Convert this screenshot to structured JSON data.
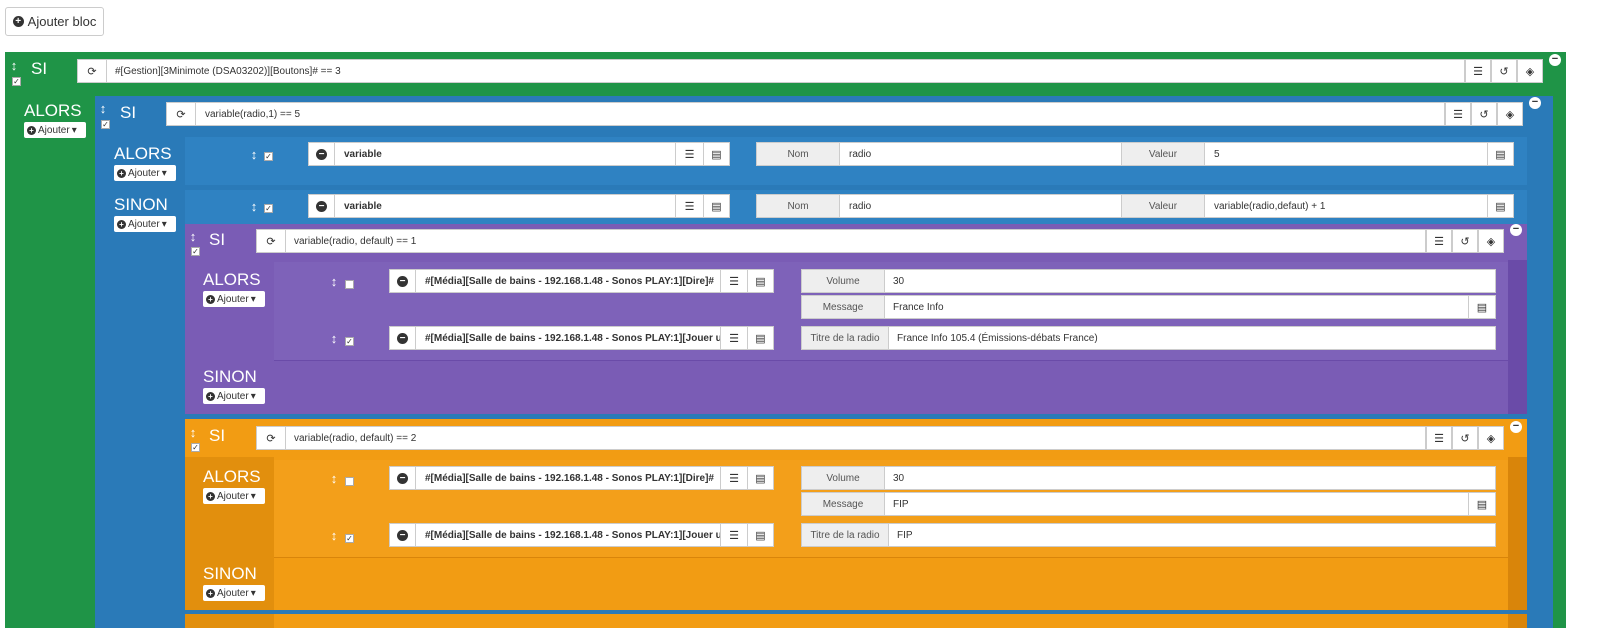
{
  "toolbar": {
    "add_block_label": "Ajouter bloc"
  },
  "labels": {
    "si": "SI",
    "alors": "ALORS",
    "sinon": "SINON",
    "ajouter": "Ajouter"
  },
  "root": {
    "condition": "#[Gestion][3Minimote (DSA03202)][Boutons]# == 3"
  },
  "blue": {
    "condition": "variable(radio,1) == 5",
    "then_action": {
      "cmd": "variable",
      "name_label": "Nom",
      "name": "radio",
      "value_label": "Valeur",
      "value": "5"
    },
    "else_action": {
      "cmd": "variable",
      "name_label": "Nom",
      "name": "radio",
      "value_label": "Valeur",
      "value": "variable(radio,defaut) + 1"
    }
  },
  "purple": {
    "condition": "variable(radio, default) == 1",
    "say": {
      "cmd": "#[Média][Salle de bains - 192.168.1.48 - Sonos PLAY:1][Dire]#",
      "volume_label": "Volume",
      "volume": "30",
      "message_label": "Message",
      "message": "France Info"
    },
    "play": {
      "cmd": "#[Média][Salle de bains - 192.168.1.48 - Sonos PLAY:1][Jouer ur",
      "title_label": "Titre de la radio",
      "title": "France Info 105.4 (Émissions-débats France)"
    }
  },
  "orange": {
    "condition": "variable(radio, default) == 2",
    "say": {
      "cmd": "#[Média][Salle de bains - 192.168.1.48 - Sonos PLAY:1][Dire]#",
      "volume_label": "Volume",
      "volume": "30",
      "message_label": "Message",
      "message": "FIP"
    },
    "play": {
      "cmd": "#[Média][Salle de bains - 192.168.1.48 - Sonos PLAY:1][Jouer ur",
      "title_label": "Titre de la radio",
      "title": "FIP"
    }
  },
  "colors": {
    "green": "#1f9447",
    "blue": "#2a7ab8",
    "purple": "#7a5cb5",
    "purple_dark": "#6a4ba8",
    "orange": "#f29c13",
    "orange_dark": "#d9850a"
  },
  "icons": [
    "plus-circle-icon",
    "arrows-vertical-icon",
    "checkbox-icon",
    "refresh-icon",
    "list-icon",
    "history-icon",
    "cube-icon",
    "minus-circle-icon"
  ]
}
